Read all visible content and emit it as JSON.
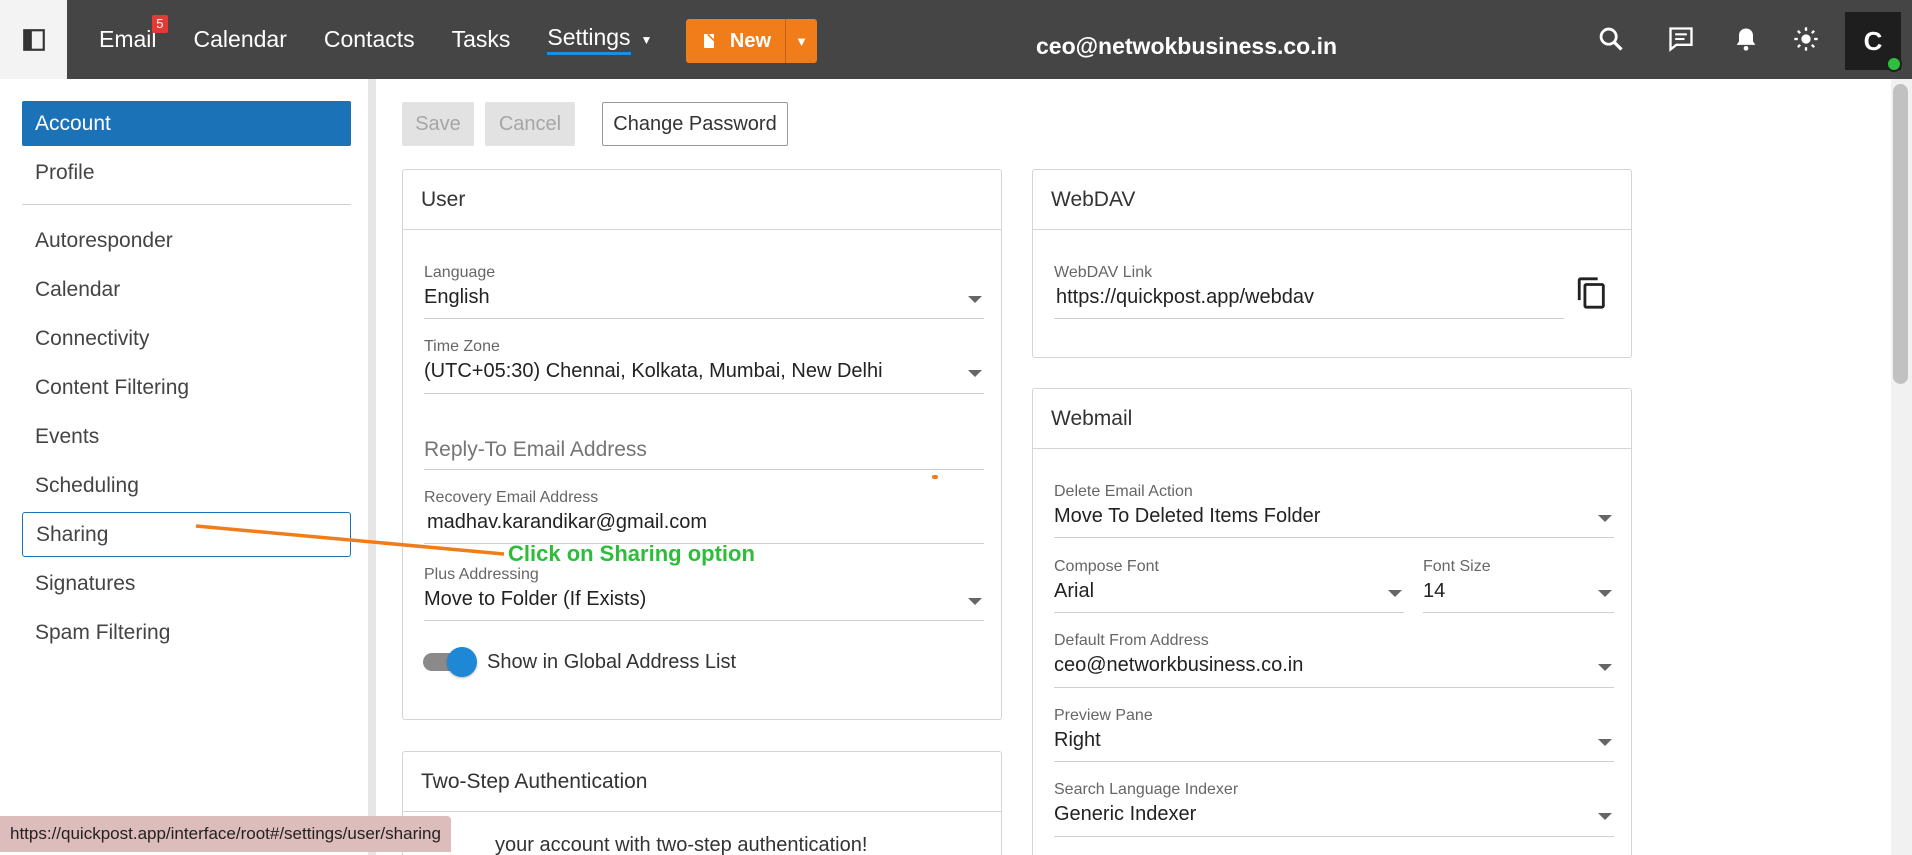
{
  "topbar": {
    "nav": [
      {
        "label": "Email",
        "badge": "5"
      },
      {
        "label": "Calendar"
      },
      {
        "label": "Contacts"
      },
      {
        "label": "Tasks"
      },
      {
        "label": "Settings"
      }
    ],
    "new_label": "New",
    "account_email": "ceo@netwokbusiness.co.in",
    "avatar_initial": "C",
    "icons": [
      "sidebar-toggle-icon",
      "search-icon",
      "chat-icon",
      "bell-icon",
      "sun-icon"
    ]
  },
  "sidebar": {
    "items": [
      {
        "label": "Account"
      },
      {
        "label": "Profile"
      },
      {
        "label": "Autoresponder"
      },
      {
        "label": "Calendar"
      },
      {
        "label": "Connectivity"
      },
      {
        "label": "Content Filtering"
      },
      {
        "label": "Events"
      },
      {
        "label": "Scheduling"
      },
      {
        "label": "Sharing"
      },
      {
        "label": "Signatures"
      },
      {
        "label": "Spam Filtering"
      }
    ]
  },
  "toolbar": {
    "save": "Save",
    "cancel": "Cancel",
    "change_password": "Change Password"
  },
  "user_card": {
    "title": "User",
    "language_label": "Language",
    "language_value": "English",
    "timezone_label": "Time Zone",
    "timezone_value": "(UTC+05:30) Chennai, Kolkata, Mumbai, New Delhi",
    "reply_to_placeholder": "Reply-To Email Address",
    "recovery_label": "Recovery Email Address",
    "recovery_value": "madhav.karandikar@gmail.com",
    "plus_label": "Plus Addressing",
    "plus_value": "Move to Folder (If Exists)",
    "gal_label": "Show in Global Address List",
    "gal_on": true
  },
  "two_step_card": {
    "title": "Two-Step Authentication",
    "body": "your account with two-step authentication!"
  },
  "webdav_card": {
    "title": "WebDAV",
    "link_label": "WebDAV Link",
    "link_value": "https://quickpost.app/webdav"
  },
  "webmail_card": {
    "title": "Webmail",
    "delete_label": "Delete Email Action",
    "delete_value": "Move To Deleted Items Folder",
    "font_label": "Compose Font",
    "font_value": "Arial",
    "size_label": "Font Size",
    "size_value": "14",
    "from_label": "Default From Address",
    "from_value": "ceo@networkbusiness.co.in",
    "preview_label": "Preview Pane",
    "preview_value": "Right",
    "indexer_label": "Search Language Indexer",
    "indexer_value": "Generic Indexer"
  },
  "annotation": {
    "text": "Click on Sharing option",
    "colors": {
      "arrow": "#f07d1a",
      "text": "#2ebd3a"
    }
  },
  "statusbar": {
    "url": "https://quickpost.app/interface/root#/settings/user/sharing"
  },
  "colors": {
    "topbar": "#454545",
    "accent_blue": "#1b72b7",
    "new_button": "#f07d1a"
  }
}
